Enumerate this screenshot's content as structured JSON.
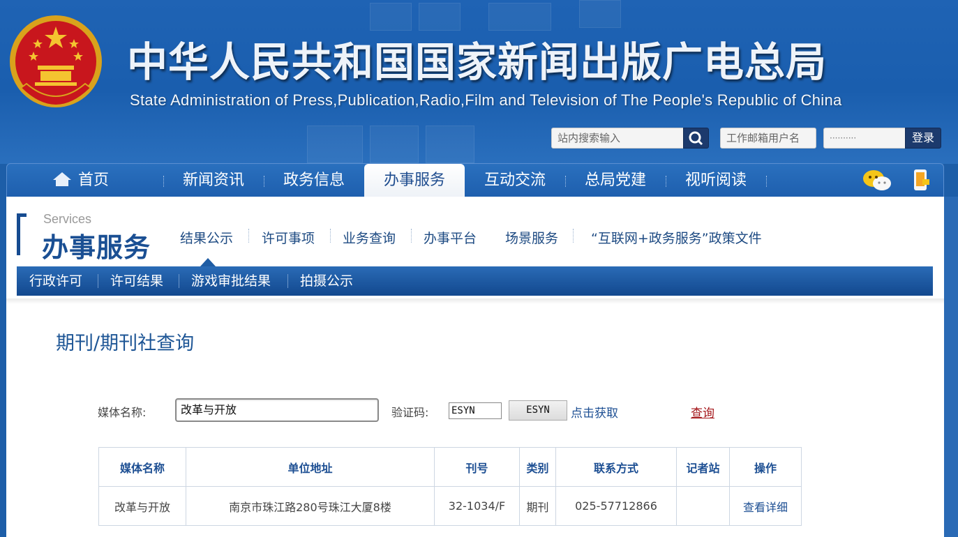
{
  "header": {
    "title": "中华人民共和国国家新闻出版广电总局",
    "subtitle": "State Administration of Press,Publication,Radio,Film and Television of The People's Republic of China",
    "search_placeholder": "站内搜索输入",
    "email_placeholder": "工作邮箱用户名",
    "password_mask": "··········",
    "login_label": "登录"
  },
  "main_nav": [
    {
      "label": "首页"
    },
    {
      "label": "新闻资讯"
    },
    {
      "label": "政务信息"
    },
    {
      "label": "办事服务"
    },
    {
      "label": "互动交流"
    },
    {
      "label": "总局党建"
    },
    {
      "label": "视听阅读"
    }
  ],
  "section": {
    "en": "Services",
    "cn": "办事服务"
  },
  "sub_nav": [
    {
      "label": "结果公示"
    },
    {
      "label": "许可事项"
    },
    {
      "label": "业务查询"
    },
    {
      "label": "办事平台"
    },
    {
      "label": "场景服务"
    },
    {
      "label": "“互联网+政务服务”政策文件"
    }
  ],
  "third_nav": [
    {
      "label": "行政许可"
    },
    {
      "label": "许可结果"
    },
    {
      "label": "游戏审批结果"
    },
    {
      "label": "拍摄公示"
    }
  ],
  "page_heading": "期刊/期刊社查询",
  "form": {
    "media_label": "媒体名称:",
    "media_value": "改革与开放",
    "captcha_label": "验证码:",
    "captcha_value": "ESYN",
    "captcha_image_text": "ESYN",
    "refresh_label": "点击获取",
    "query_label": "查询"
  },
  "table": {
    "headers": [
      "媒体名称",
      "单位地址",
      "刊号",
      "类别",
      "联系方式",
      "记者站",
      "操作"
    ],
    "rows": [
      [
        "改革与开放",
        "南京市珠江路280号珠江大厦8楼",
        "32-1034/F",
        "期刊",
        "025-57712866",
        "",
        "查看详细"
      ]
    ]
  },
  "colors": {
    "header_blue": "#1d5ea8",
    "nav_text_active": "#1f4d8f",
    "link_blue": "#1d4f93",
    "query_red": "#a4161a"
  },
  "icons": {
    "home": "home-icon",
    "search": "search-icon",
    "wechat": "wechat-icon",
    "mobile": "mobile-icon",
    "emblem": "national-emblem"
  }
}
